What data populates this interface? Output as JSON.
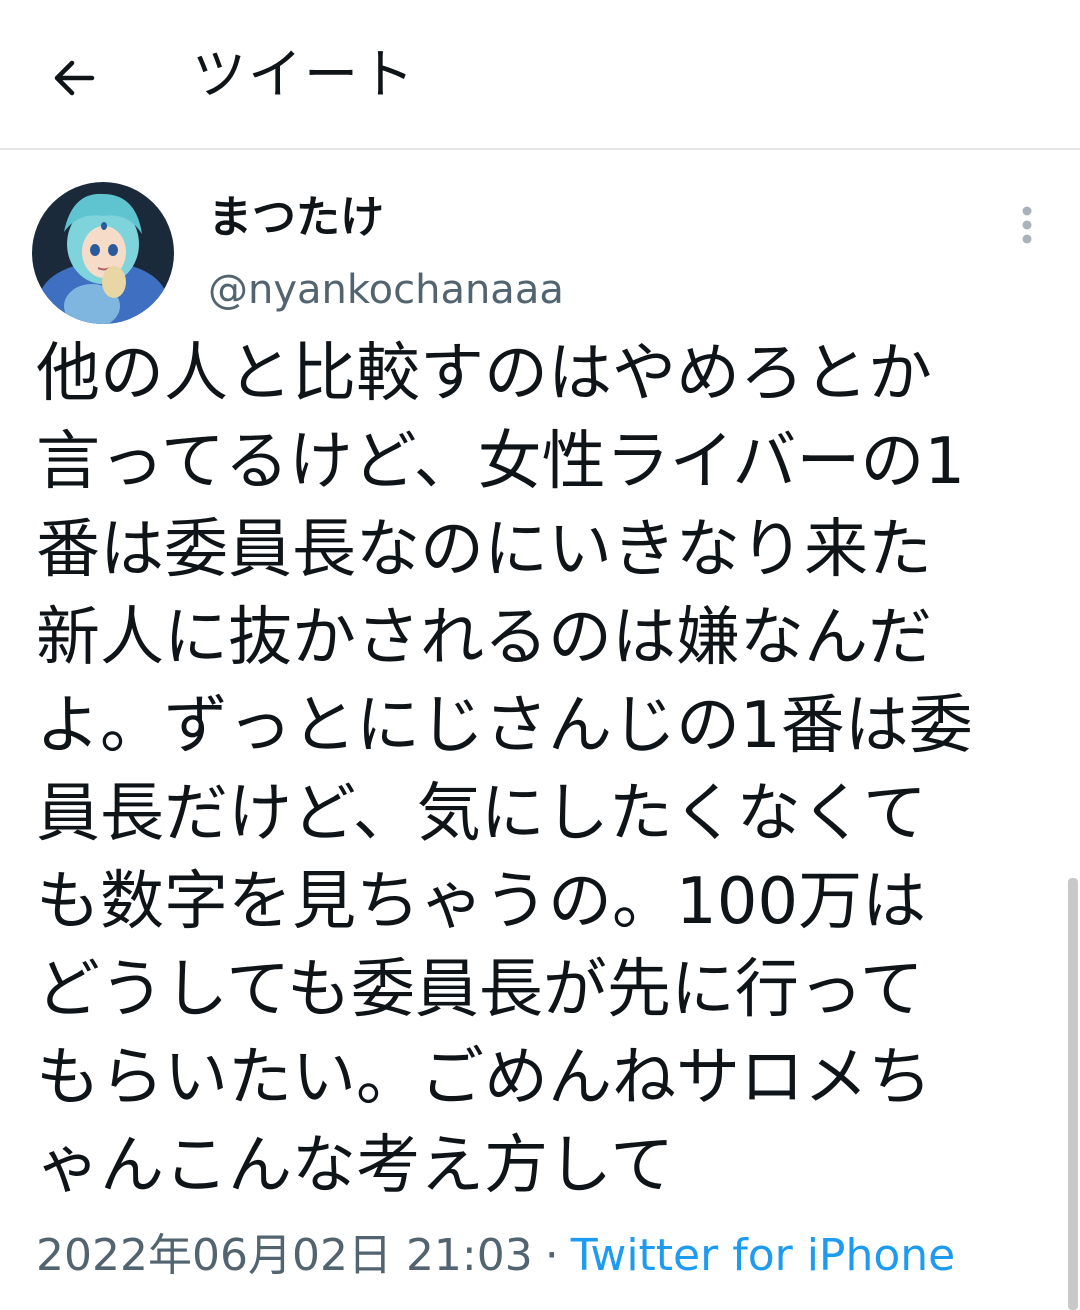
{
  "header": {
    "title": "ツイート",
    "back_icon": "arrow-left-icon"
  },
  "tweet": {
    "author": {
      "display_name": "まつたけ",
      "handle": "@nyankochanaaa",
      "avatar_icon": "user-avatar"
    },
    "more_icon": "more-vertical-icon",
    "lines": [
      "他の人と比較すのはやめろとか",
      "言ってるけど、女性ライバーの1",
      "番は委員長なのにいきなり来た",
      "新人に抜かされるのは嫌なんだ",
      "よ。ずっとにじさんじの1番は委",
      "員長だけど、気にしたくなくて",
      "も数字を見ちゃうの。100万は",
      "どうしても委員長が先に行って",
      "もらいたい。ごめんねサロメち",
      "ゃんこんな考え方して"
    ],
    "timestamp": "2022年06月02日 21:03",
    "separator": "·",
    "source": "Twitter for iPhone"
  },
  "colors": {
    "text": "#0f1419",
    "secondary": "#536471",
    "link": "#1d9bf0",
    "divider": "#e6e6e6"
  }
}
